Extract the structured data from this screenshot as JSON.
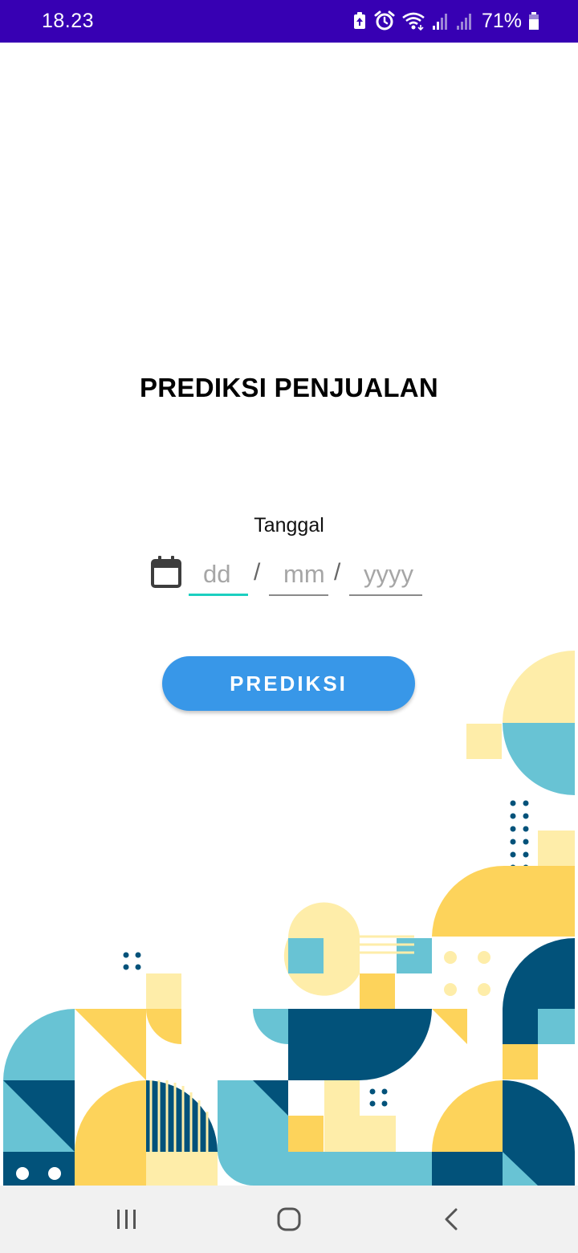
{
  "status_bar": {
    "time": "18.23",
    "battery_percent": "71%",
    "icons": [
      "battery-saver-icon",
      "alarm-icon",
      "wifi-icon",
      "signal-icon",
      "signal-icon",
      "battery-icon"
    ]
  },
  "main": {
    "title": "PREDIKSI PENJUALAN",
    "date_label": "Tanggal",
    "date_inputs": {
      "day_placeholder": "dd",
      "month_placeholder": "mm",
      "year_placeholder": "yyyy",
      "separator": "/"
    },
    "predict_button": "PREDIKSI"
  },
  "nav_bar": {
    "icons": [
      "recent-apps-icon",
      "home-icon",
      "back-icon"
    ]
  },
  "colors": {
    "status_bar": "#3700b3",
    "button": "#3897e8",
    "active_underline": "#1ccfc0",
    "navy": "#02527a",
    "teal": "#68c3d4",
    "yellow": "#fdd35b",
    "pale_yellow": "#feeda9"
  }
}
